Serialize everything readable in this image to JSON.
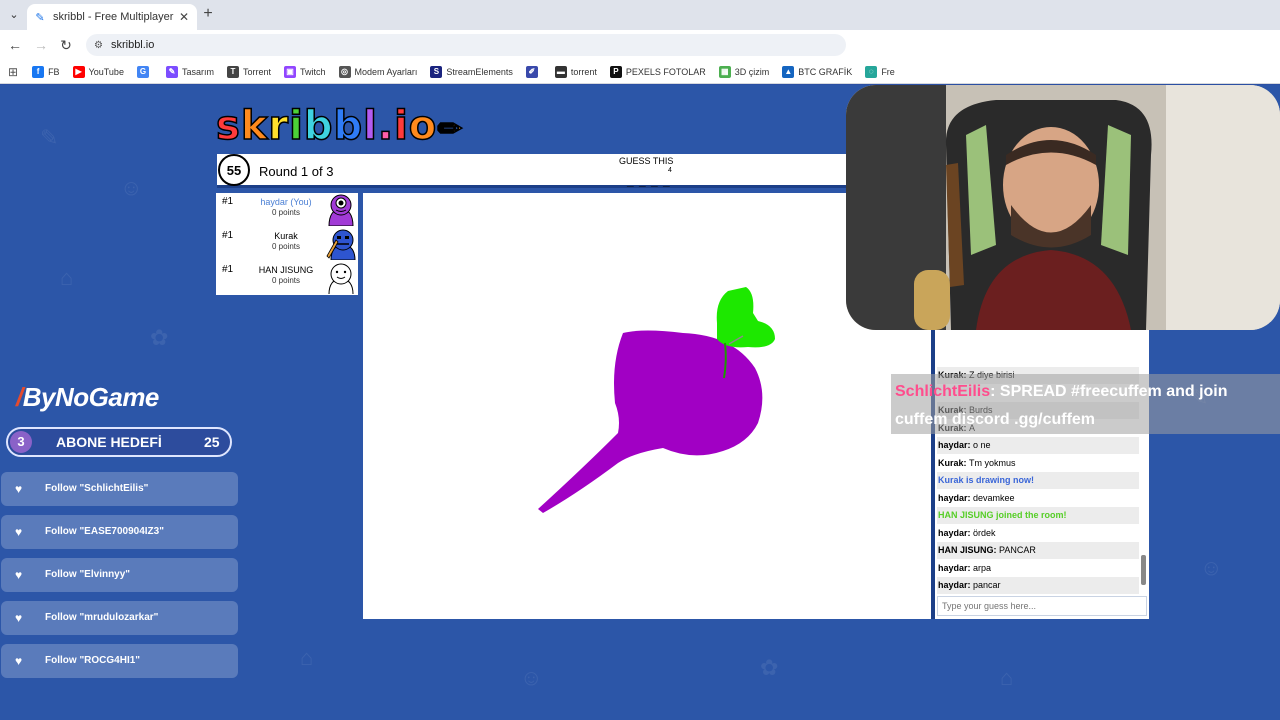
{
  "browser": {
    "tab_title": "skribbl - Free Multiplayer Draw",
    "tab_close": "✕",
    "new_tab": "+",
    "url": "skribbl.io",
    "bookmarks": [
      {
        "label": "FB",
        "icon": "facebook-icon",
        "color": "#1877f2",
        "glyph": "f"
      },
      {
        "label": "YouTube",
        "icon": "youtube-icon",
        "color": "#ff0000",
        "glyph": "▶"
      },
      {
        "label": "",
        "icon": "google-icon",
        "color": "#4285f4",
        "glyph": "G"
      },
      {
        "label": "Tasarım",
        "icon": "tasarim-icon",
        "color": "#7c4dff",
        "glyph": "✎"
      },
      {
        "label": "Torrent",
        "icon": "torrent-icon",
        "color": "#444444",
        "glyph": "T"
      },
      {
        "label": "Twitch",
        "icon": "twitch-icon",
        "color": "#9146ff",
        "glyph": "▣"
      },
      {
        "label": "Modem Ayarları",
        "icon": "globe-icon",
        "color": "#555555",
        "glyph": "◎"
      },
      {
        "label": "StreamElements",
        "icon": "streamelements-icon",
        "color": "#1a237e",
        "glyph": "S"
      },
      {
        "label": "",
        "icon": "feather-icon",
        "color": "#3949ab",
        "glyph": "✐"
      },
      {
        "label": "torrent",
        "icon": "torrent2-icon",
        "color": "#333333",
        "glyph": "▬"
      },
      {
        "label": "PEXELS FOTOLAR",
        "icon": "pexels-icon",
        "color": "#111111",
        "glyph": "P"
      },
      {
        "label": "3D çizim",
        "icon": "grid-icon",
        "color": "#4caf50",
        "glyph": "▦"
      },
      {
        "label": "BTC GRAFİK",
        "icon": "chart-icon",
        "color": "#1565c0",
        "glyph": "▲"
      },
      {
        "label": "Fre",
        "icon": "free-icon",
        "color": "#26a69a",
        "glyph": "◌"
      }
    ]
  },
  "game": {
    "timer": "55",
    "round": "Round 1 of 3",
    "guess_label": "GUESS THIS",
    "word_length": "4",
    "word_blanks": "_ _ _ _",
    "players": [
      {
        "rank": "#1",
        "name": "haydar (You)",
        "points": "0 points",
        "color": "#4a7fd4"
      },
      {
        "rank": "#1",
        "name": "Kurak",
        "points": "0 points",
        "color": "#000000"
      },
      {
        "rank": "#1",
        "name": "HAN JISUNG",
        "points": "0 points",
        "color": "#000000"
      }
    ]
  },
  "chat": {
    "messages": [
      {
        "author": "Kurak",
        "text": "Z diye birisi",
        "kind": "normal"
      },
      {
        "author": "",
        "text": "",
        "kind": "hidden"
      },
      {
        "author": "Kurak",
        "text": "Burds",
        "kind": "normal"
      },
      {
        "author": "Kurak",
        "text": "A",
        "kind": "normal"
      },
      {
        "author": "haydar",
        "text": "o ne",
        "kind": "normal"
      },
      {
        "author": "Kurak",
        "text": "Tm yokmus",
        "kind": "normal"
      },
      {
        "author": "",
        "text": "Kurak is drawing now!",
        "kind": "system-blue"
      },
      {
        "author": "haydar",
        "text": "devamkee",
        "kind": "normal"
      },
      {
        "author": "",
        "text": "HAN JISUNG joined the room!",
        "kind": "system-green"
      },
      {
        "author": "haydar",
        "text": "ördek",
        "kind": "normal"
      },
      {
        "author": "HAN JISUNG",
        "text": "PANCAR",
        "kind": "normal"
      },
      {
        "author": "haydar",
        "text": "arpa",
        "kind": "normal"
      },
      {
        "author": "haydar",
        "text": "pancar",
        "kind": "normal"
      }
    ],
    "input_placeholder": "Type your guess here..."
  },
  "overlay": {
    "author": "SchlichtEilis",
    "text": ": SPREAD #freecuffem and join cuffem discord .gg/cuffem"
  },
  "stream": {
    "brand": "ByNoGame",
    "goal": {
      "current": "3",
      "label": "ABONE HEDEFİ",
      "target": "25"
    },
    "follows": [
      "Follow \"SchlichtEilis\"",
      "Follow \"EASE700904IZ3\"",
      "Follow \"Elvinnyy\"",
      "Follow \"mrudulozarkar\"",
      "Follow \"ROCG4HI1\""
    ]
  },
  "colors": {
    "page_bg": "#2c56a8",
    "drawing_purple": "#a100c4",
    "drawing_green": "#1de800",
    "system_blue": "#3a66d8",
    "system_green": "#56ce27"
  }
}
